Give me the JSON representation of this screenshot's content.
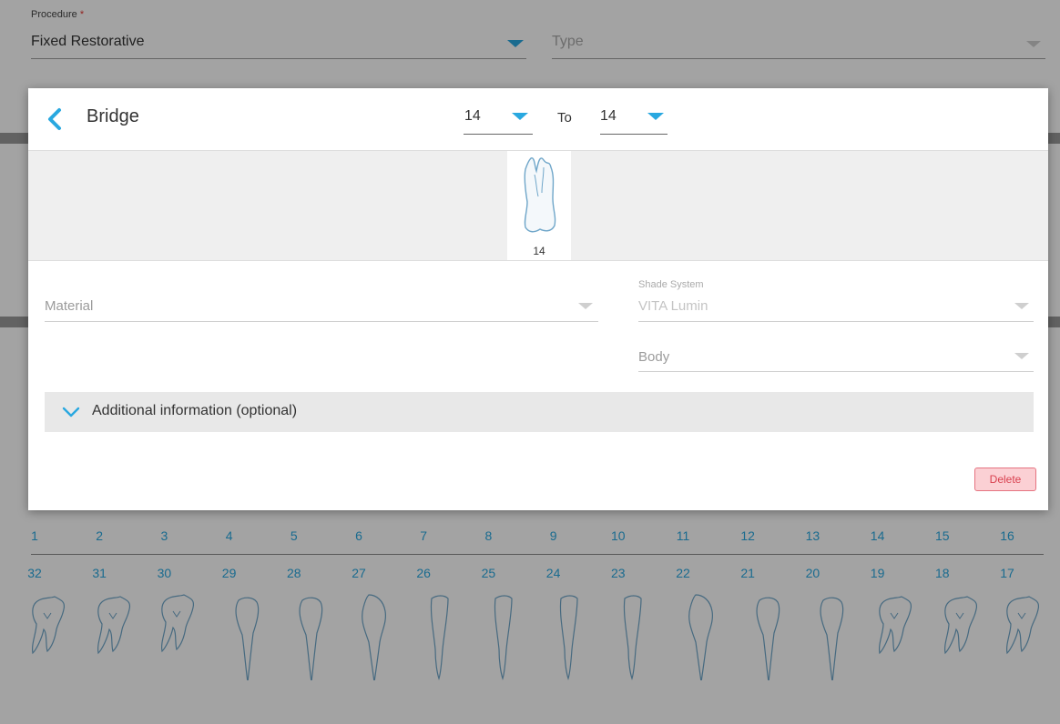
{
  "form": {
    "procedure_label": "Procedure",
    "required_mark": "*",
    "procedure_value": "Fixed Restorative",
    "type_placeholder": "Type"
  },
  "upper_numbers": [
    "1",
    "2",
    "3",
    "4",
    "5",
    "6",
    "7",
    "8",
    "9",
    "10",
    "11",
    "12",
    "13",
    "14",
    "15",
    "16"
  ],
  "lower_numbers": [
    "32",
    "31",
    "30",
    "29",
    "28",
    "27",
    "26",
    "25",
    "24",
    "23",
    "22",
    "21",
    "20",
    "19",
    "18",
    "17"
  ],
  "modal": {
    "title": "Bridge",
    "from_value": "14",
    "to_label": "To",
    "to_value": "14",
    "selected_tooth": "14",
    "material_placeholder": "Material",
    "shade_system_label": "Shade System",
    "shade_system_value": "VITA Lumin",
    "body_placeholder": "Body",
    "additional_info_label": "Additional information (optional)",
    "delete_label": "Delete"
  },
  "colors": {
    "accent": "#29a8e0",
    "delete_bg": "#fbd0d4",
    "delete_border": "#e57380",
    "delete_text": "#d9414f",
    "strip_bg": "#efefef",
    "additional_bg": "#e8e8e8"
  }
}
